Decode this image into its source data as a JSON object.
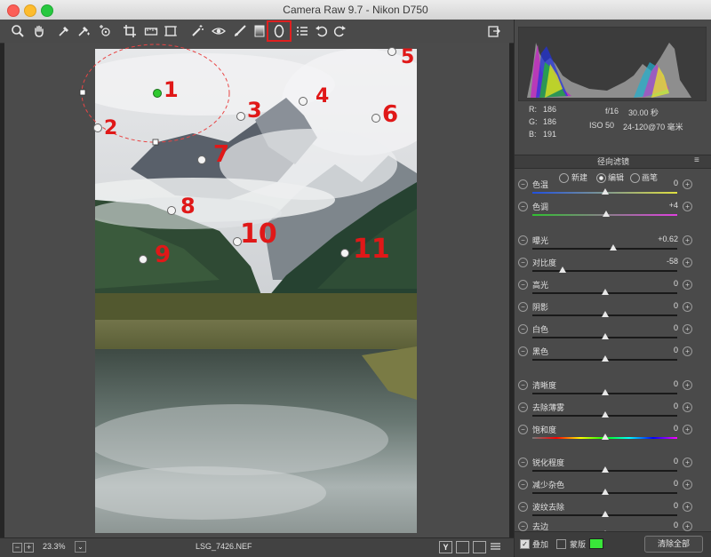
{
  "window": {
    "title": "Camera Raw 9.7 -  Nikon D750"
  },
  "toolbar": {
    "tools": [
      "zoom-icon",
      "hand-icon",
      "white-balance-icon",
      "color-sampler-icon",
      "target-adjust-icon",
      "crop-icon",
      "straighten-icon",
      "transform-icon",
      "spot-removal-icon",
      "red-eye-icon",
      "adjustment-brush-icon",
      "graduated-filter-icon",
      "radial-filter-icon",
      "presets-icon",
      "rotate-ccw-icon",
      "rotate-cw-icon"
    ],
    "selected_tool": "radial-filter-icon",
    "open_icon": "open-object-icon"
  },
  "annotations": [
    "1",
    "2",
    "3",
    "4",
    "5",
    "6",
    "7",
    "8",
    "9",
    "10",
    "11"
  ],
  "info": {
    "r_label": "R:",
    "r_value": "186",
    "g_label": "G:",
    "g_value": "186",
    "b_label": "B:",
    "b_value": "191",
    "aperture": "f/16",
    "shutter": "30.00 秒",
    "iso": "ISO 50",
    "lens": "24-120@70 毫米"
  },
  "panel": {
    "title": "径向滤镜",
    "modes": [
      "新建",
      "编辑",
      "画笔"
    ],
    "selected_mode": "编辑"
  },
  "sliders": [
    {
      "label": "色温",
      "value": "0",
      "pos": 0.5
    },
    {
      "label": "色调",
      "value": "+4",
      "pos": 0.51
    },
    {
      "label": "曝光",
      "value": "+0.62",
      "pos": 0.56
    },
    {
      "label": "对比度",
      "value": "-58",
      "pos": 0.21
    },
    {
      "label": "高光",
      "value": "0",
      "pos": 0.5
    },
    {
      "label": "阴影",
      "value": "0",
      "pos": 0.5
    },
    {
      "label": "白色",
      "value": "0",
      "pos": 0.5
    },
    {
      "label": "黑色",
      "value": "0",
      "pos": 0.5
    },
    {
      "label": "清晰度",
      "value": "0",
      "pos": 0.5
    },
    {
      "label": "去除薄雾",
      "value": "0",
      "pos": 0.5
    },
    {
      "label": "饱和度",
      "value": "0",
      "pos": 0.5
    },
    {
      "label": "锐化程度",
      "value": "0",
      "pos": 0.5
    },
    {
      "label": "减少杂色",
      "value": "0",
      "pos": 0.5
    },
    {
      "label": "波纹去除",
      "value": "0",
      "pos": 0.5
    },
    {
      "label": "去边",
      "value": "0",
      "pos": 0.5
    }
  ],
  "footer": {
    "overlay_label": "叠加",
    "overlay_checked": true,
    "mask_label": "蒙版",
    "mask_checked": false,
    "mask_color": "#39e639",
    "clear_label": "清除全部"
  },
  "bottombar": {
    "zoom": "23.3%",
    "filename": "LSG_7426.NEF",
    "view_buttons": [
      "Y"
    ]
  }
}
